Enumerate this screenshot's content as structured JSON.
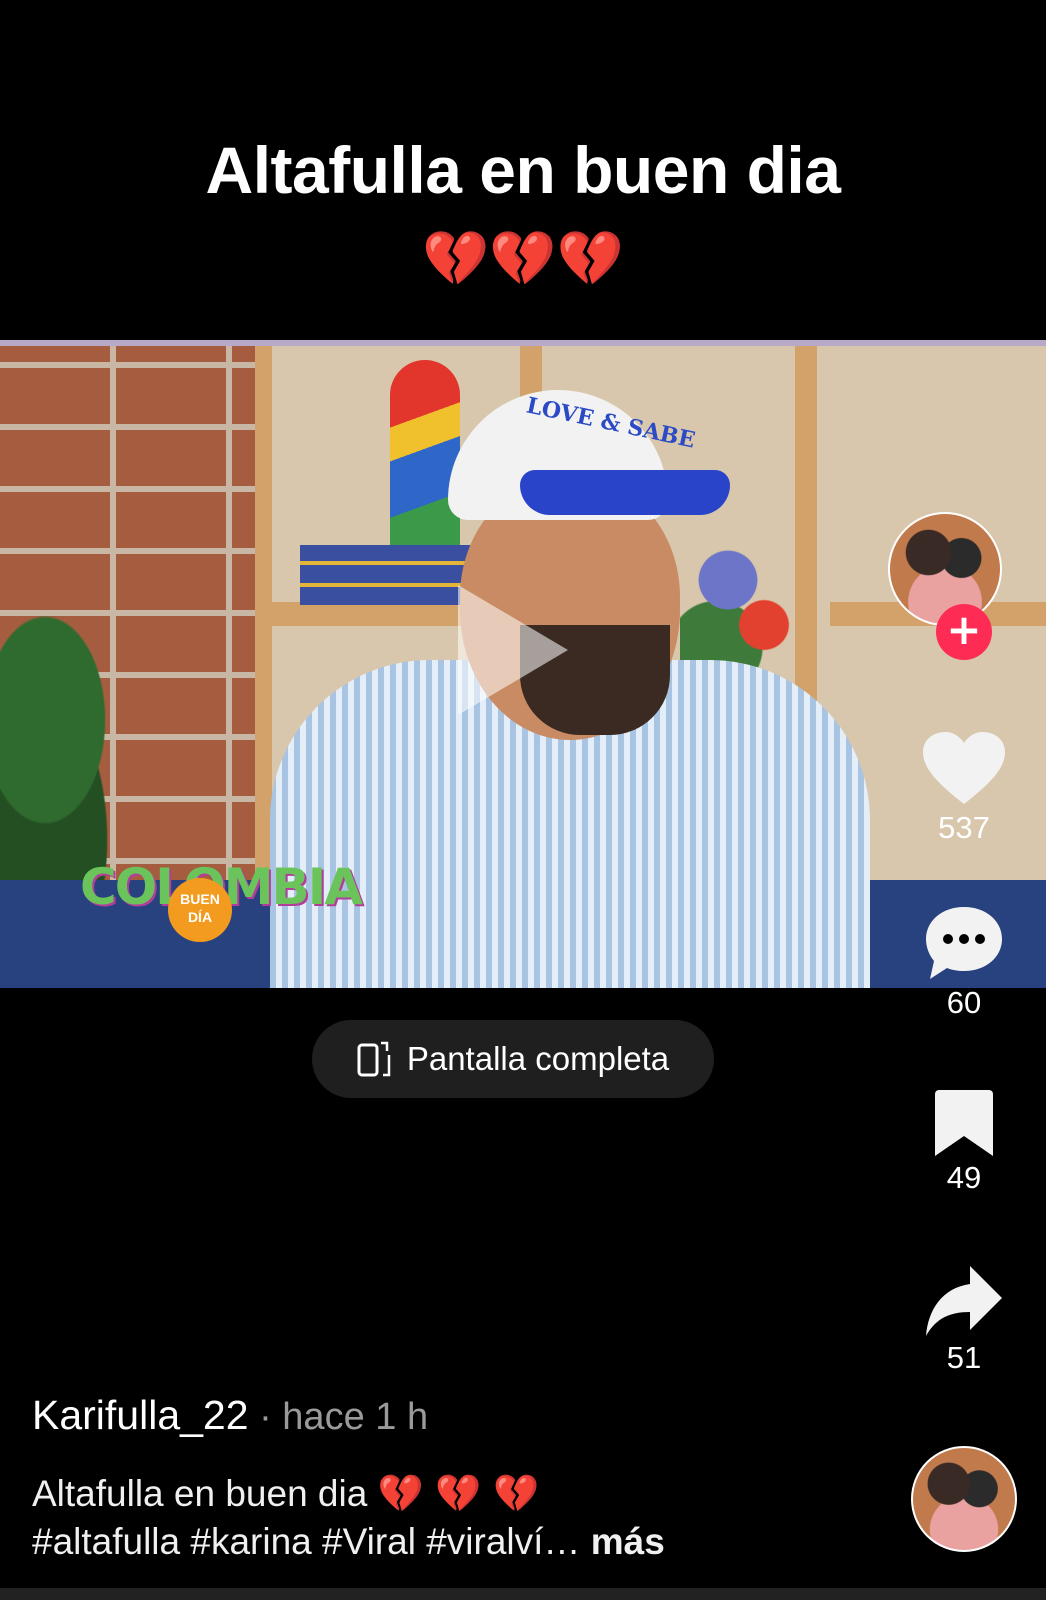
{
  "overlay": {
    "title": "Altafulla en buen dia",
    "emoji": "💔💔💔"
  },
  "video": {
    "cap_text": "LOVE & SABE",
    "logo_text": "COLOMBIA",
    "logo_badge": "BUEN DÍA"
  },
  "fullscreen": {
    "label": "Pantalla completa",
    "icon": "fullscreen-rotate-icon"
  },
  "actions": {
    "likes": "537",
    "comments": "60",
    "saves": "49",
    "shares": "51"
  },
  "post": {
    "author": "Karifulla_22",
    "time": " · hace 1 h",
    "caption_text": "Altafulla en buen dia ",
    "caption_emoji": "💔 💔 💔",
    "hashtags": "#altafulla #karina #Viral #viralví…",
    "more": " más"
  },
  "colors": {
    "accent": "#fe2c55",
    "background": "#000000",
    "muted": "#9a9a9a"
  }
}
